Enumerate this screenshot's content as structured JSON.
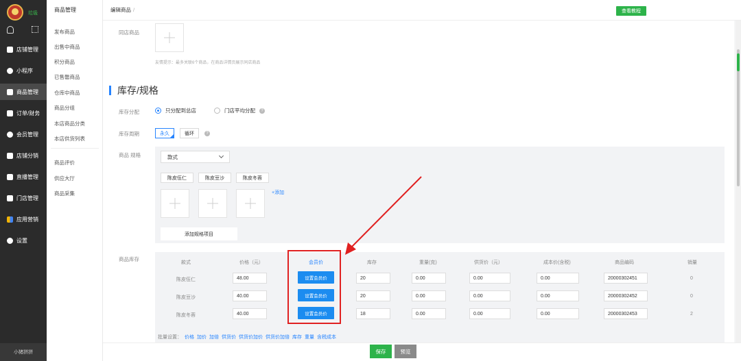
{
  "sidebar": {
    "shop_name": "垃圾",
    "footer": "小猪拼拼",
    "items": [
      {
        "label": "店铺管理",
        "icon": "store-icon"
      },
      {
        "label": "小程序",
        "icon": "miniprogram-icon"
      },
      {
        "label": "商品管理",
        "icon": "goods-icon"
      },
      {
        "label": "订单/财务",
        "icon": "order-icon"
      },
      {
        "label": "会员管理",
        "icon": "member-icon"
      },
      {
        "label": "店铺分销",
        "icon": "distribution-icon"
      },
      {
        "label": "直播管理",
        "icon": "live-icon"
      },
      {
        "label": "门店管理",
        "icon": "shop-icon"
      },
      {
        "label": "应用营销",
        "icon": "apps-icon"
      },
      {
        "label": "设置",
        "icon": "gear-icon"
      }
    ]
  },
  "submenu": {
    "title": "商品管理",
    "items": [
      "发布商品",
      "出售中商品",
      "积分商品",
      "已售罄商品",
      "仓库中商品",
      "商品分组",
      "本店商品分类",
      "本店供货列表",
      "商品评价",
      "供应大厅",
      "商品采集"
    ]
  },
  "header": {
    "breadcrumb": "编辑商品",
    "slash": "/",
    "tutorial_label": "查看教程"
  },
  "form": {
    "same_shop_label": "同店商品",
    "hint": "友情提示：最多关联6个商品，在商品详情页展示同店商品",
    "section_title": "库存/规格",
    "stock_alloc_label": "库存分配",
    "alloc_option_1": "只分配到总店",
    "alloc_option_2": "门店平均分配",
    "stock_cycle_label": "库存周期",
    "cycle_option_1": "永久",
    "cycle_option_2": "循环",
    "spec_label": "商品 规格",
    "spec_select_value": "款式",
    "spec_values": [
      "陈皮伍仁",
      "陈皮豆沙",
      "陈皮冬蓉"
    ],
    "add_link": "+添加",
    "add_spec_item": "添加规格项目",
    "stock_label": "商品库存"
  },
  "stock_table": {
    "headers": [
      "款式",
      "价格（元）",
      "会员价",
      "库存",
      "重量(克)",
      "供货价（元）",
      "成本价(含税)",
      "商品编码",
      "销量"
    ],
    "member_button": "设置会员价",
    "rows": [
      {
        "name": "陈皮伍仁",
        "price": "48.00",
        "stock": "20",
        "weight": "0.00",
        "supply": "0.00",
        "cost": "0.00",
        "code": "20000302451",
        "sales": "0"
      },
      {
        "name": "陈皮豆沙",
        "price": "40.00",
        "stock": "20",
        "weight": "0.00",
        "supply": "0.00",
        "cost": "0.00",
        "code": "20000302452",
        "sales": "0"
      },
      {
        "name": "陈皮冬蓉",
        "price": "40.00",
        "stock": "18",
        "weight": "0.00",
        "supply": "0.00",
        "cost": "0.00",
        "code": "20000302453",
        "sales": "2"
      }
    ],
    "batch_label": "批量设置：",
    "batch_links": [
      "价格",
      "加价",
      "加倍",
      "供货价",
      "供货价加价",
      "供货价加倍",
      "库存",
      "重量",
      "含税成本"
    ]
  },
  "footer_bar": {
    "save_label": "保存",
    "preview_label": "预览"
  },
  "colors": {
    "accent": "#2684ff",
    "green": "#2db34a",
    "highlight": "#e02020"
  }
}
